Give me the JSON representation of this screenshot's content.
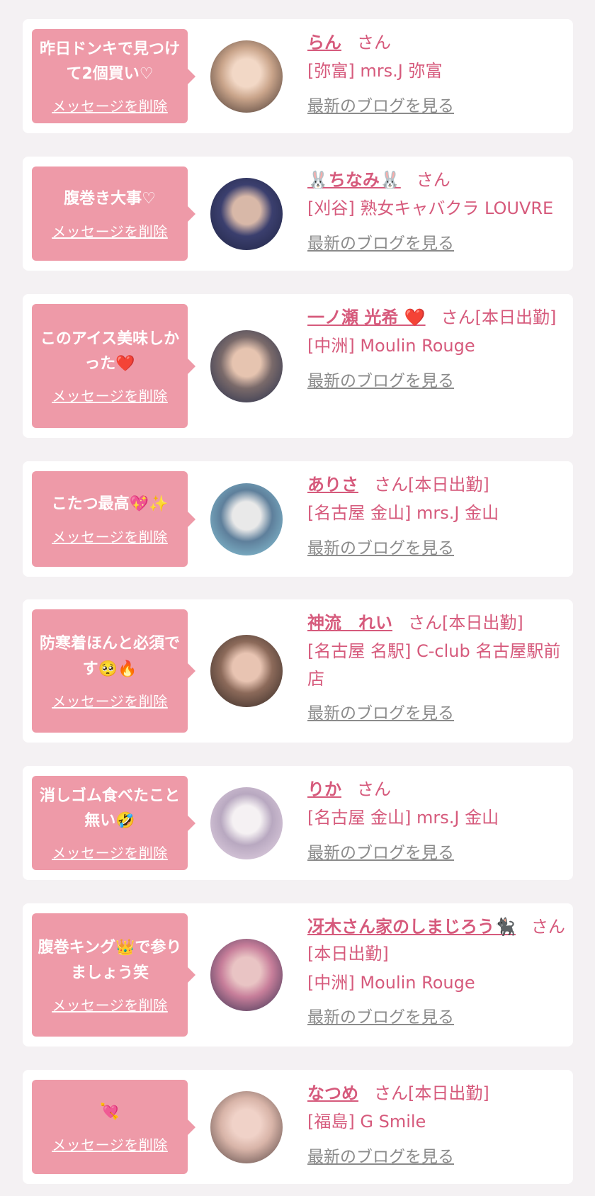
{
  "colors": {
    "background": "#f4f1f3",
    "card": "#ffffff",
    "bubble": "#ee9aa8",
    "accent": "#d65a7c",
    "link_gray": "#8b8b8b"
  },
  "messages": [
    {
      "text": "昨日ドンキで見つけて2個買い♡",
      "delete_label": "メッセージを削除",
      "name": "らん",
      "suffix": "さん",
      "shop": "[弥富] mrs.J 弥富",
      "blog_label": "最新のブログを見る",
      "avatar_colors": [
        "#3a2d2a",
        "#c9a48a",
        "#f2d8c6"
      ]
    },
    {
      "text": "腹巻き大事♡",
      "delete_label": "メッセージを削除",
      "name": "🐰ちなみ🐰",
      "suffix": "さん",
      "shop": "[刈谷] 熟女キャバクラ LOUVRE",
      "blog_label": "最新のブログを見る",
      "avatar_colors": [
        "#1d2240",
        "#3b3f6e",
        "#d8b8a8"
      ]
    },
    {
      "text": "このアイス美味しかった❤️",
      "delete_label": "メッセージを削除",
      "name": "一ノ瀬 光希 ❤️",
      "suffix": "さん[本日出勤]",
      "shop": "[中洲] Moulin Rouge",
      "blog_label": "最新のブログを見る",
      "avatar_colors": [
        "#1f2a4a",
        "#7a6a6a",
        "#e6c4b0"
      ]
    },
    {
      "text": "こたつ最高💖✨",
      "delete_label": "メッセージを削除",
      "name": "ありさ",
      "suffix": "さん[本日出勤]",
      "shop": "[名古屋 金山] mrs.J 金山",
      "blog_label": "最新のブログを見る",
      "avatar_colors": [
        "#8fcfe0",
        "#5e7f9b",
        "#e9e9e9"
      ]
    },
    {
      "text": "防寒着ほんと必須です🥺🔥",
      "delete_label": "メッセージを削除",
      "name": "神流　れい",
      "suffix": "さん[本日出勤]",
      "shop": "[名古屋 名駅] C-club 名古屋駅前店",
      "blog_label": "最新のブログを見る",
      "avatar_colors": [
        "#2b221f",
        "#8c6a5a",
        "#e8c4b2"
      ]
    },
    {
      "text": "消しゴム食べたこと無い🤣",
      "delete_label": "メッセージを削除",
      "name": "りか",
      "suffix": "さん",
      "shop": "[名古屋 金山] mrs.J 金山",
      "blog_label": "最新のブログを見る",
      "avatar_colors": [
        "#e9d9e8",
        "#b8a8c0",
        "#f5f1f3"
      ]
    },
    {
      "text": "腹巻キング👑で参りましょう笑",
      "delete_label": "メッセージを削除",
      "name": "冴木さん家のしまじろう🐈‍⬛",
      "suffix": "さん[本日出勤]",
      "shop": "[中洲] Moulin Rouge",
      "blog_label": "最新のブログを見る",
      "avatar_colors": [
        "#2a2a4a",
        "#c77e9a",
        "#e9c4c4"
      ]
    },
    {
      "text": "💘",
      "delete_label": "メッセージを削除",
      "name": "なつめ",
      "suffix": "さん[本日出勤]",
      "shop": "[福島] G Smile",
      "blog_label": "最新のブログを見る",
      "avatar_colors": [
        "#4a3a3a",
        "#d8b4a8",
        "#f0d2c8"
      ]
    }
  ]
}
